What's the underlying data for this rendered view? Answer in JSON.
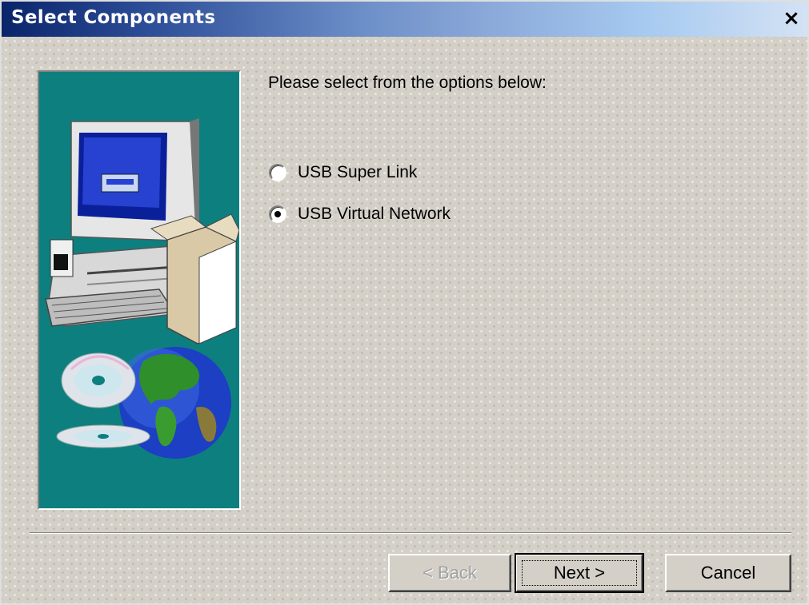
{
  "window": {
    "title": "Select Components",
    "close_label": "×"
  },
  "content": {
    "prompt": "Please select from the options below:",
    "options": [
      {
        "label": "USB Super Link",
        "selected": false
      },
      {
        "label": "USB Virtual Network",
        "selected": true
      }
    ]
  },
  "buttons": {
    "back": "< Back",
    "next": "Next >",
    "cancel": "Cancel"
  },
  "colors": {
    "title_start": "#0a246a",
    "title_end": "#d4e2f4",
    "panel_bg": "#0e7f7f",
    "dialog_bg": "#d4d0c8"
  },
  "icons": {
    "art": "computer-cd-globe-illustration",
    "close": "close-icon"
  }
}
